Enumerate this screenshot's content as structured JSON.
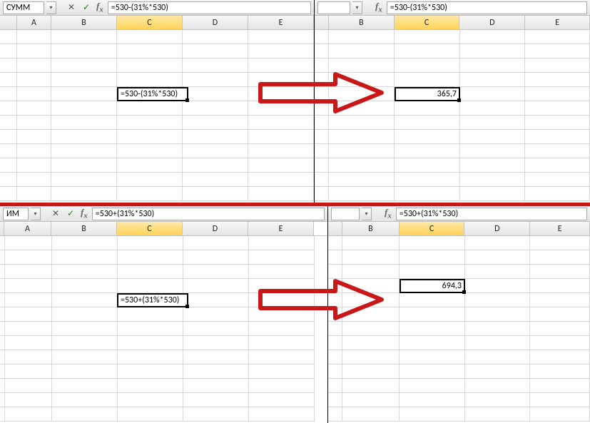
{
  "panes": {
    "tl": {
      "namebox": "СУММ",
      "formula": "=530-(31%*530)",
      "editing": true,
      "activeCell": {
        "col": "C",
        "row": 5,
        "value": "=530-(31%*530)",
        "align": "l"
      }
    },
    "tr": {
      "namebox": "",
      "formula": "=530-(31%*530)",
      "editing": false,
      "activeCell": {
        "col": "C",
        "row": 5,
        "value": "365,7",
        "align": "r"
      }
    },
    "bl": {
      "namebox": "ИМ",
      "formula": "=530+(31%*530)",
      "editing": true,
      "activeCell": {
        "col": "C",
        "row": 5,
        "value": "=530+(31%*530)",
        "align": "l"
      }
    },
    "br": {
      "namebox": "",
      "formula": "=530+(31%*530)",
      "editing": false,
      "activeCell": {
        "col": "C",
        "row": 5,
        "value": "694,3",
        "align": "r"
      }
    }
  },
  "cols": [
    "A",
    "B",
    "C",
    "D",
    "E"
  ],
  "icons": {
    "dropdown": "▾",
    "cancel": "✕",
    "enter": "✓"
  },
  "fx_label": "fx"
}
